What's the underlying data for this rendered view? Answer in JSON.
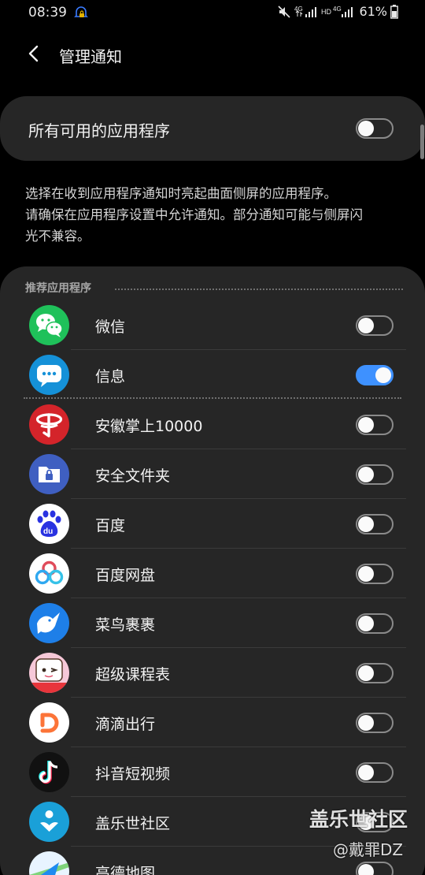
{
  "status_bar": {
    "time": "08:39",
    "network_label_1": "4G",
    "hd_label": "HD",
    "network_label_2": "4G",
    "battery_text": "61%"
  },
  "header": {
    "title": "管理通知",
    "back_icon": "chevron-left-icon"
  },
  "master_toggle": {
    "label": "所有可用的应用程序",
    "on": false
  },
  "description": {
    "line1": "选择在收到应用程序通知时亮起曲面侧屏的应用程序。",
    "line2": "请确保在应用程序设置中允许通知。部分通知可能与侧屏闪",
    "line3": "光不兼容。"
  },
  "apps_section": {
    "title": "推荐应用程序",
    "apps": [
      {
        "name": "微信",
        "icon": "wechat-icon",
        "on": false
      },
      {
        "name": "信息",
        "icon": "messages-icon",
        "on": true
      },
      {
        "name": "安徽掌上10000",
        "icon": "china-telecom-icon",
        "on": false
      },
      {
        "name": "安全文件夹",
        "icon": "secure-folder-icon",
        "on": false
      },
      {
        "name": "百度",
        "icon": "baidu-icon",
        "on": false
      },
      {
        "name": "百度网盘",
        "icon": "baidu-netdisk-icon",
        "on": false
      },
      {
        "name": "菜鸟裹裹",
        "icon": "cainiao-icon",
        "on": false
      },
      {
        "name": "超级课程表",
        "icon": "super-schedule-icon",
        "on": false
      },
      {
        "name": "滴滴出行",
        "icon": "didi-icon",
        "on": false
      },
      {
        "name": "抖音短视频",
        "icon": "douyin-icon",
        "on": false
      },
      {
        "name": "盖乐世社区",
        "icon": "galaxy-community-icon",
        "on": false
      },
      {
        "name": "高德地图",
        "icon": "amap-icon",
        "on": false
      }
    ]
  },
  "watermark": {
    "main": "盖乐世社区",
    "sub": "@戴罪DZ"
  },
  "colors": {
    "background": "#000000",
    "card": "#262626",
    "toggle_on": "#3e91ff",
    "toggle_off_border": "#8a8a8a"
  }
}
